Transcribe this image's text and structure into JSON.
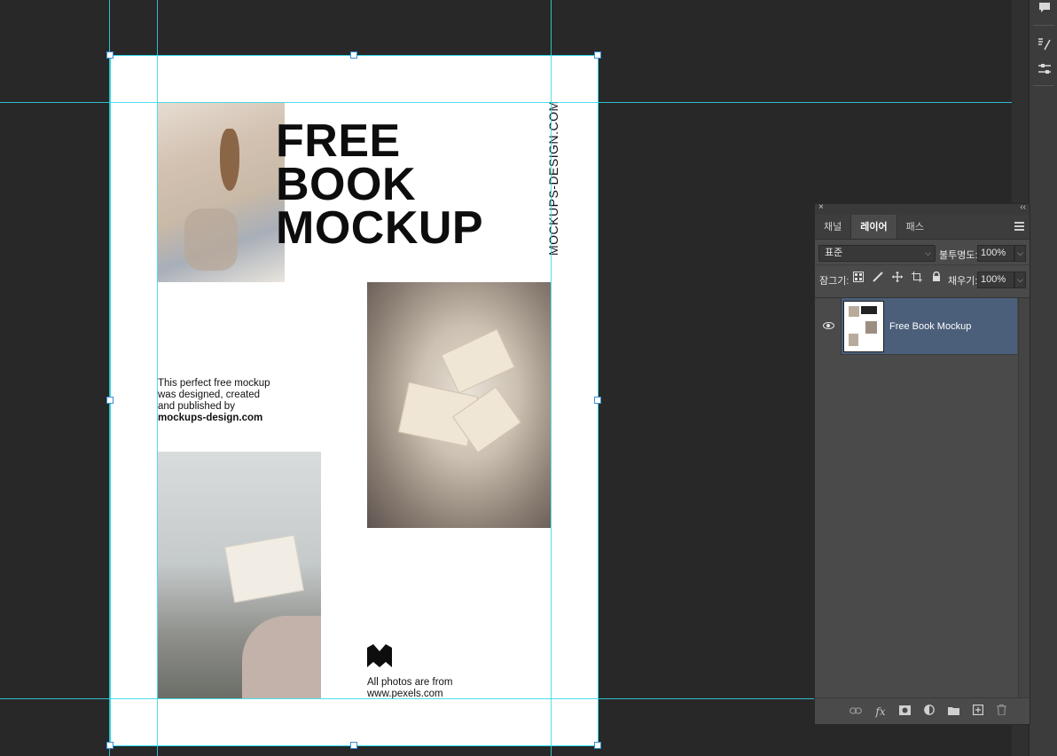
{
  "document": {
    "title_lines": [
      "FREE",
      "BOOK",
      "MOCKUP"
    ],
    "vertical_text": "MOCKUPS-DESIGN.COM",
    "blurb_lines": [
      "This perfect free mockup",
      "was designed, created",
      "and published by"
    ],
    "blurb_link": "mockups-design.com",
    "credit_lines": [
      "All photos are from",
      "www.pexels.com"
    ]
  },
  "layers_panel": {
    "close_glyph": "×",
    "collapse_glyph": "‹‹",
    "tabs": [
      {
        "label": "채널",
        "active": false
      },
      {
        "label": "레이어",
        "active": true
      },
      {
        "label": "패스",
        "active": false
      }
    ],
    "blend_mode": "표준",
    "opacity_label": "불투명도:",
    "opacity_value": "100%",
    "lock_label": "잠그기:",
    "fill_label": "채우기:",
    "fill_value": "100%",
    "layers": [
      {
        "name": "Free Book Mockup",
        "visible": true,
        "selected": true
      }
    ],
    "footer_icons": [
      "link-icon",
      "fx-icon",
      "mask-icon",
      "adjustment-icon",
      "folder-icon",
      "new-layer-icon",
      "trash-icon"
    ]
  },
  "right_strip": {
    "icons": [
      "comment-icon",
      "brush-settings-icon",
      "properties-icon"
    ]
  },
  "colors": {
    "canvas_bg": "#282828",
    "guide": "#33d7e6",
    "selected_layer": "#4b5f7a",
    "panel_bg": "#4a4a4a"
  }
}
